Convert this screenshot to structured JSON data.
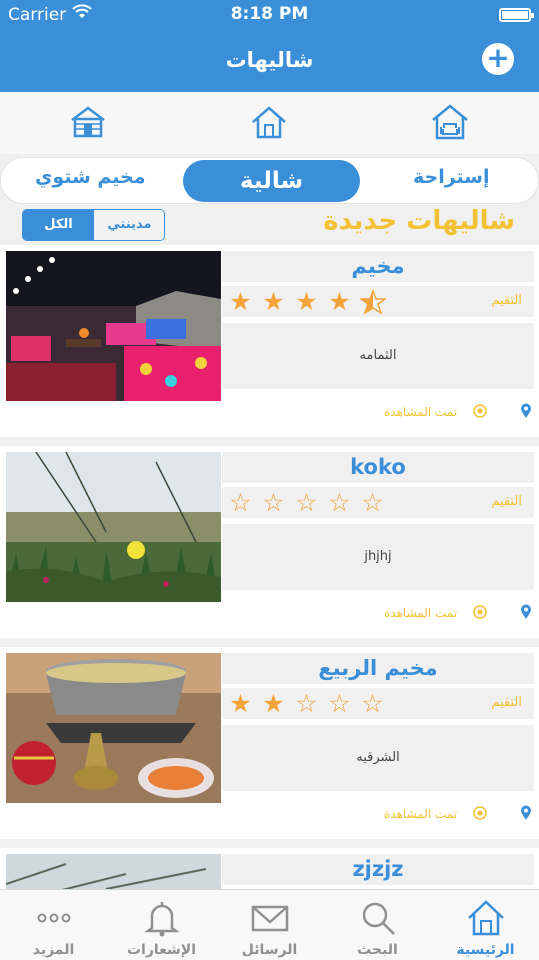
{
  "status": {
    "carrier": "Carrier",
    "time": "8:18 PM"
  },
  "nav": {
    "title": "شاليهات",
    "add_icon": "plus-icon"
  },
  "types": [
    {
      "icon": "cabin-icon"
    },
    {
      "icon": "house-icon"
    },
    {
      "icon": "rest-house-icon"
    }
  ],
  "segments": {
    "winter_camp": "مخيم شتوي",
    "chalet": "شالية",
    "rest_house": "إستراحة",
    "selected": "شالية"
  },
  "filter": {
    "all": "الكل",
    "my_city": "مدينتي",
    "selected": "الكل"
  },
  "section_title": "شاليهات جديدة",
  "listings": [
    {
      "name": "مخيم",
      "rating_label": "التقيم",
      "rating": 4.5,
      "description": "الثمامه",
      "viewed_label": "تمت المشاهدة"
    },
    {
      "name": "koko",
      "rating_label": "التقيم",
      "rating": 0,
      "description": "jhjhj",
      "viewed_label": "تمت المشاهدة"
    },
    {
      "name": "مخيم الربيع",
      "rating_label": "التقيم",
      "rating": 2,
      "description": "الشرقيه",
      "viewed_label": "تمت المشاهدة"
    },
    {
      "name": "zjzjz"
    }
  ],
  "tabs": {
    "home": "الرئيسية",
    "search": "البحث",
    "messages": "الرسائل",
    "notifications": "الإشعارات",
    "more": "المزيد",
    "selected": "الرئيسية"
  },
  "colors": {
    "primary": "#3a8fd8",
    "accent": "#f2c234",
    "star": "#f2a33a"
  }
}
